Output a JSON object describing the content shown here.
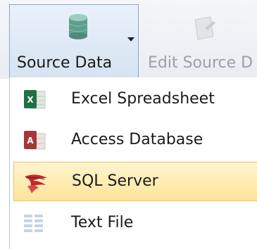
{
  "ribbon": {
    "source_data_label": "Source Data",
    "edit_source_label": "Edit Source D"
  },
  "menu": {
    "items": [
      {
        "label": "Excel Spreadsheet",
        "icon": "excel-icon",
        "selected": false
      },
      {
        "label": "Access Database",
        "icon": "access-icon",
        "selected": false
      },
      {
        "label": "SQL Server",
        "icon": "sql-server-icon",
        "selected": true
      },
      {
        "label": "Text File",
        "icon": "text-file-icon",
        "selected": false
      }
    ]
  },
  "colors": {
    "highlight": "#fde59a",
    "highlight_border": "#e7c465",
    "excel_green": "#1e7145",
    "access_red": "#a4373a"
  }
}
